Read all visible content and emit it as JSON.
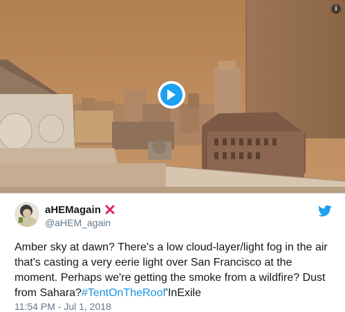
{
  "media": {
    "info_label": "i",
    "play_icon": "play-icon",
    "scene": "amber-sky-city-rooftop"
  },
  "user": {
    "display_name": "aHEMagain",
    "badge_icon": "red-x-icon",
    "handle": "@aHEM_again"
  },
  "tweet": {
    "text_part1": "Amber sky at dawn? There's a low cloud-layer/light fog in the air that's casting a very eerie light over San Francisco at the moment. Perhaps we're getting the smoke from a wildfire? Dust from Sahara?",
    "hashtag": "#TentOnTheRoof",
    "text_part2": "'InExile",
    "timestamp": "11:54 PM - Jul 1, 2018"
  },
  "colors": {
    "sky": "#b9875a",
    "link": "#1b95e0",
    "brand": "#1da1f2",
    "badge": "#e0245e"
  },
  "icons": [
    "info-icon",
    "play-icon",
    "red-x-icon",
    "twitter-bird-icon"
  ]
}
